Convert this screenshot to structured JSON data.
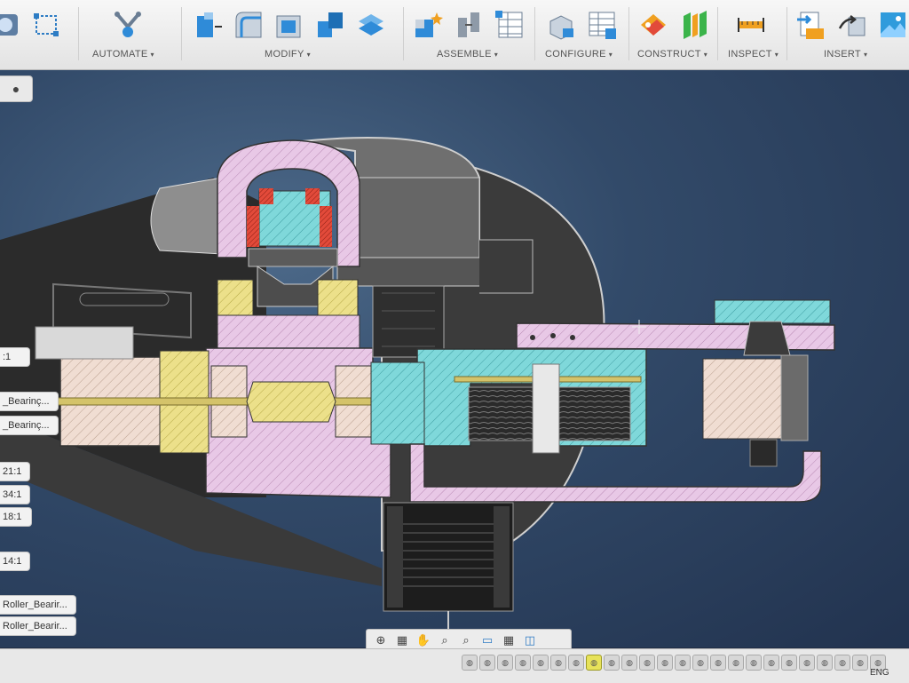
{
  "toolbar": {
    "groups": [
      {
        "label": "AUTOMATE",
        "caret": "▾",
        "icons": [
          "automate-icon"
        ]
      },
      {
        "label": "MODIFY",
        "caret": "▾",
        "icons": [
          "press-pull-icon",
          "fillet-icon",
          "shell-icon",
          "combine-icon",
          "offset-face-icon"
        ]
      },
      {
        "label": "ASSEMBLE",
        "caret": "▾",
        "icons": [
          "new-component-icon",
          "joint-icon",
          "component-table-icon"
        ]
      },
      {
        "label": "CONFIGURE",
        "caret": "▾",
        "icons": [
          "configure-icon",
          "configuration-table-icon"
        ]
      },
      {
        "label": "CONSTRUCT",
        "caret": "▾",
        "icons": [
          "offset-plane-icon",
          "midplane-icon"
        ]
      },
      {
        "label": "INSPECT",
        "caret": "▾",
        "icons": [
          "measure-icon"
        ]
      },
      {
        "label": "INSERT",
        "caret": "▾",
        "icons": [
          "insert-mcmaster-icon",
          "insert-mesh-icon",
          "insert-canvas-icon"
        ]
      }
    ],
    "left_icons": [
      "record-icon",
      "select-box-icon"
    ]
  },
  "browser": {
    "toggle_icon": "●",
    "items": [
      ":1",
      "_Bearinç...",
      "_Bearinç...",
      "21:1",
      "34:1",
      "18:1",
      "14:1",
      "Roller_Bearir...",
      "Roller_Bearir..."
    ]
  },
  "navbar": {
    "buttons": [
      "orbit-icon",
      "pan-icon",
      "hand-icon",
      "zoom-icon",
      "zoom-window-icon",
      "display-settings-icon",
      "grid-icon",
      "viewports-icon"
    ]
  },
  "timeline": {
    "operation_count": 24,
    "active_index": 7
  },
  "status": {
    "language": "ENG"
  },
  "colors": {
    "canvas_dark": "#22334f",
    "section_pink": "#e8c8e6",
    "section_cyan": "#7fd8da",
    "section_yellow": "#ece08a",
    "section_beige": "#f0ddd2",
    "part_gray": "#6b6b6b",
    "accent_red": "#e24a3a"
  }
}
